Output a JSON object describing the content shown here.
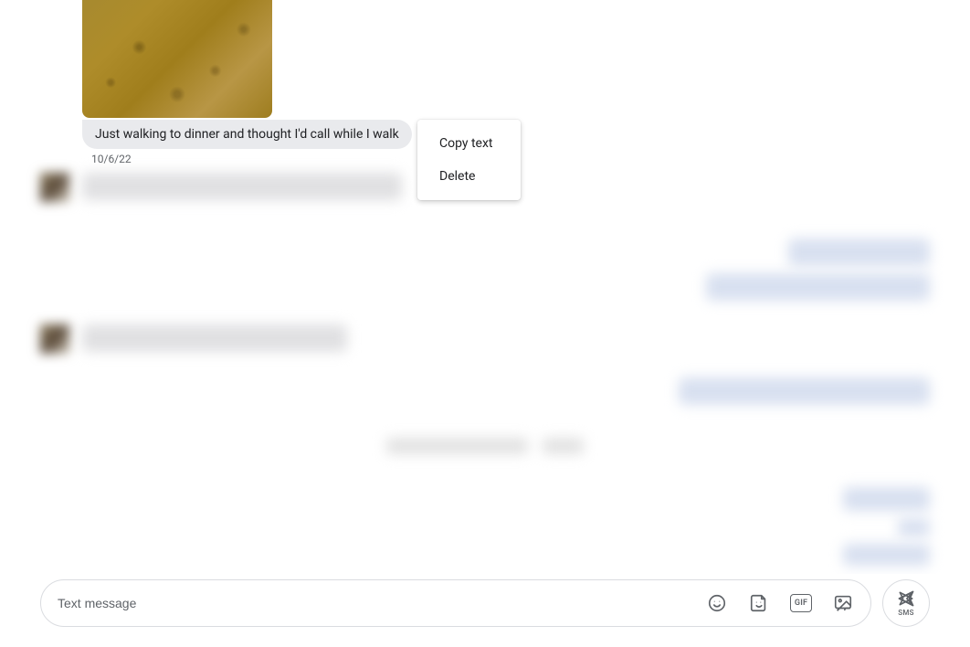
{
  "message": {
    "text": "Just walking to dinner and thought I'd call while I walk",
    "timestamp": "10/6/22"
  },
  "context_menu": {
    "copy": "Copy text",
    "delete": "Delete"
  },
  "composer": {
    "placeholder": "Text message",
    "gif_label": "GIF",
    "send_label": "SMS"
  }
}
